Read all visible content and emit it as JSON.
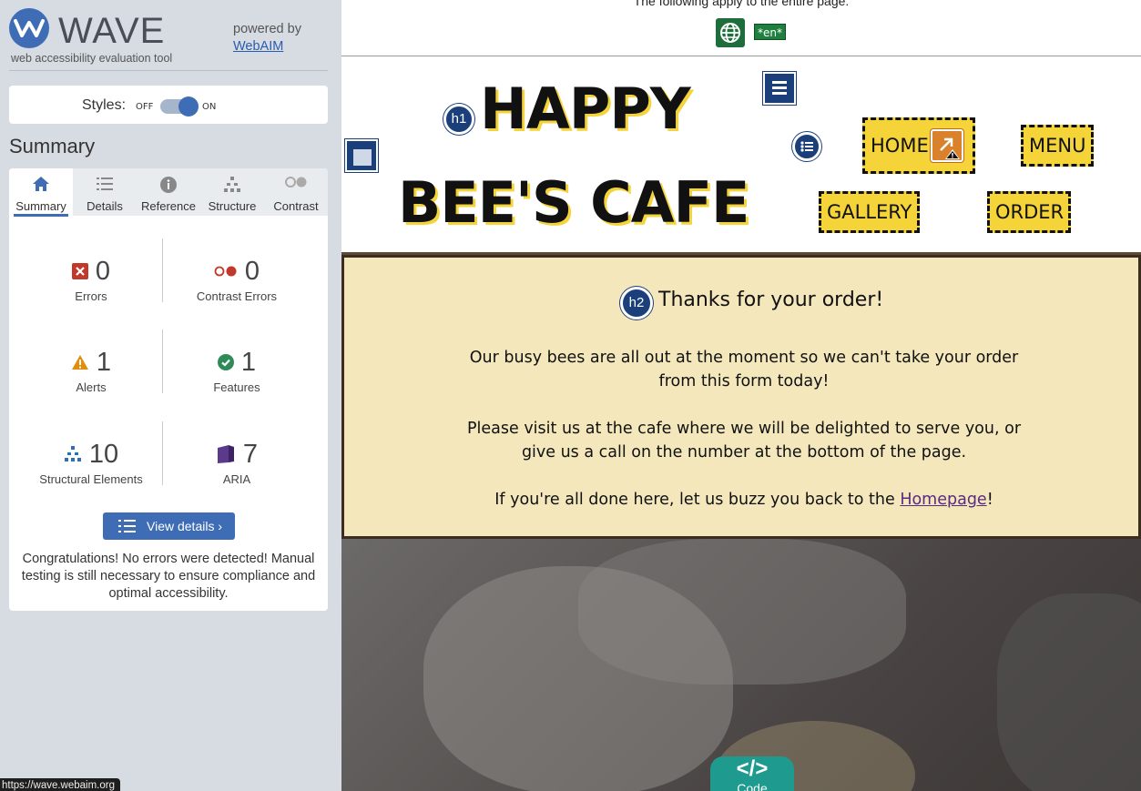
{
  "wave": {
    "logo_text": "WAVE",
    "tagline": "web accessibility evaluation tool",
    "powered_by": "powered by",
    "webaim_link": "WebAIM",
    "styles_label": "Styles:",
    "styles_off": "OFF",
    "styles_on": "ON",
    "styles_enabled": true,
    "summary_heading": "Summary",
    "tabs": [
      {
        "label": "Summary",
        "icon": "home-icon",
        "active": true
      },
      {
        "label": "Details",
        "icon": "list-icon",
        "active": false
      },
      {
        "label": "Reference",
        "icon": "info-icon",
        "active": false
      },
      {
        "label": "Structure",
        "icon": "structure-icon",
        "active": false
      },
      {
        "label": "Contrast",
        "icon": "contrast-icon",
        "active": false
      }
    ],
    "stats": {
      "errors": {
        "count": "0",
        "label": "Errors"
      },
      "contrast_errors": {
        "count": "0",
        "label": "Contrast Errors"
      },
      "alerts": {
        "count": "1",
        "label": "Alerts"
      },
      "features": {
        "count": "1",
        "label": "Features"
      },
      "structural": {
        "count": "10",
        "label": "Structural Elements"
      },
      "aria": {
        "count": "7",
        "label": "ARIA"
      }
    },
    "view_details": "View details ›",
    "congrats": "Congratulations! No errors were detected! Manual testing is still necessary to ensure compliance and optimal accessibility.",
    "status_url": "https://wave.webaim.org"
  },
  "page": {
    "doc_note": "The following apply to the entire page:",
    "lang_badge": "*en*",
    "brand_line1": "HAPPY",
    "brand_line2": "BEE'S CAFE",
    "h1_badge": "h1",
    "h2_badge": "h2",
    "nav": {
      "home": "HOME",
      "menu": "MENU",
      "gallery": "GALLERY",
      "order": "ORDER"
    },
    "order_title": "Thanks for your order!",
    "para1_line1": "Our busy bees are all out at the moment so we can't take your order",
    "para1_line2": "from this form today!",
    "para2_line1": "Please visit us at the cafe where we will be delighted to serve you, or",
    "para2_line2": "give us a call on the number at the bottom of the page.",
    "para3_prefix": "If you're all done here, let us buzz you back to the ",
    "para3_link": "Homepage",
    "para3_suffix": "!",
    "code_tab_icon": "</>",
    "code_tab_label": "Code"
  },
  "colors": {
    "wave_blue": "#3f6db5",
    "sidebar_bg": "#d7dce3",
    "brand_yellow": "#f5d43a",
    "order_bg": "#f3e7bb",
    "error_red": "#c0392b",
    "alert_orange": "#e08e0b",
    "feature_green": "#2e8b57",
    "aria_purple": "#5b3a8c"
  }
}
